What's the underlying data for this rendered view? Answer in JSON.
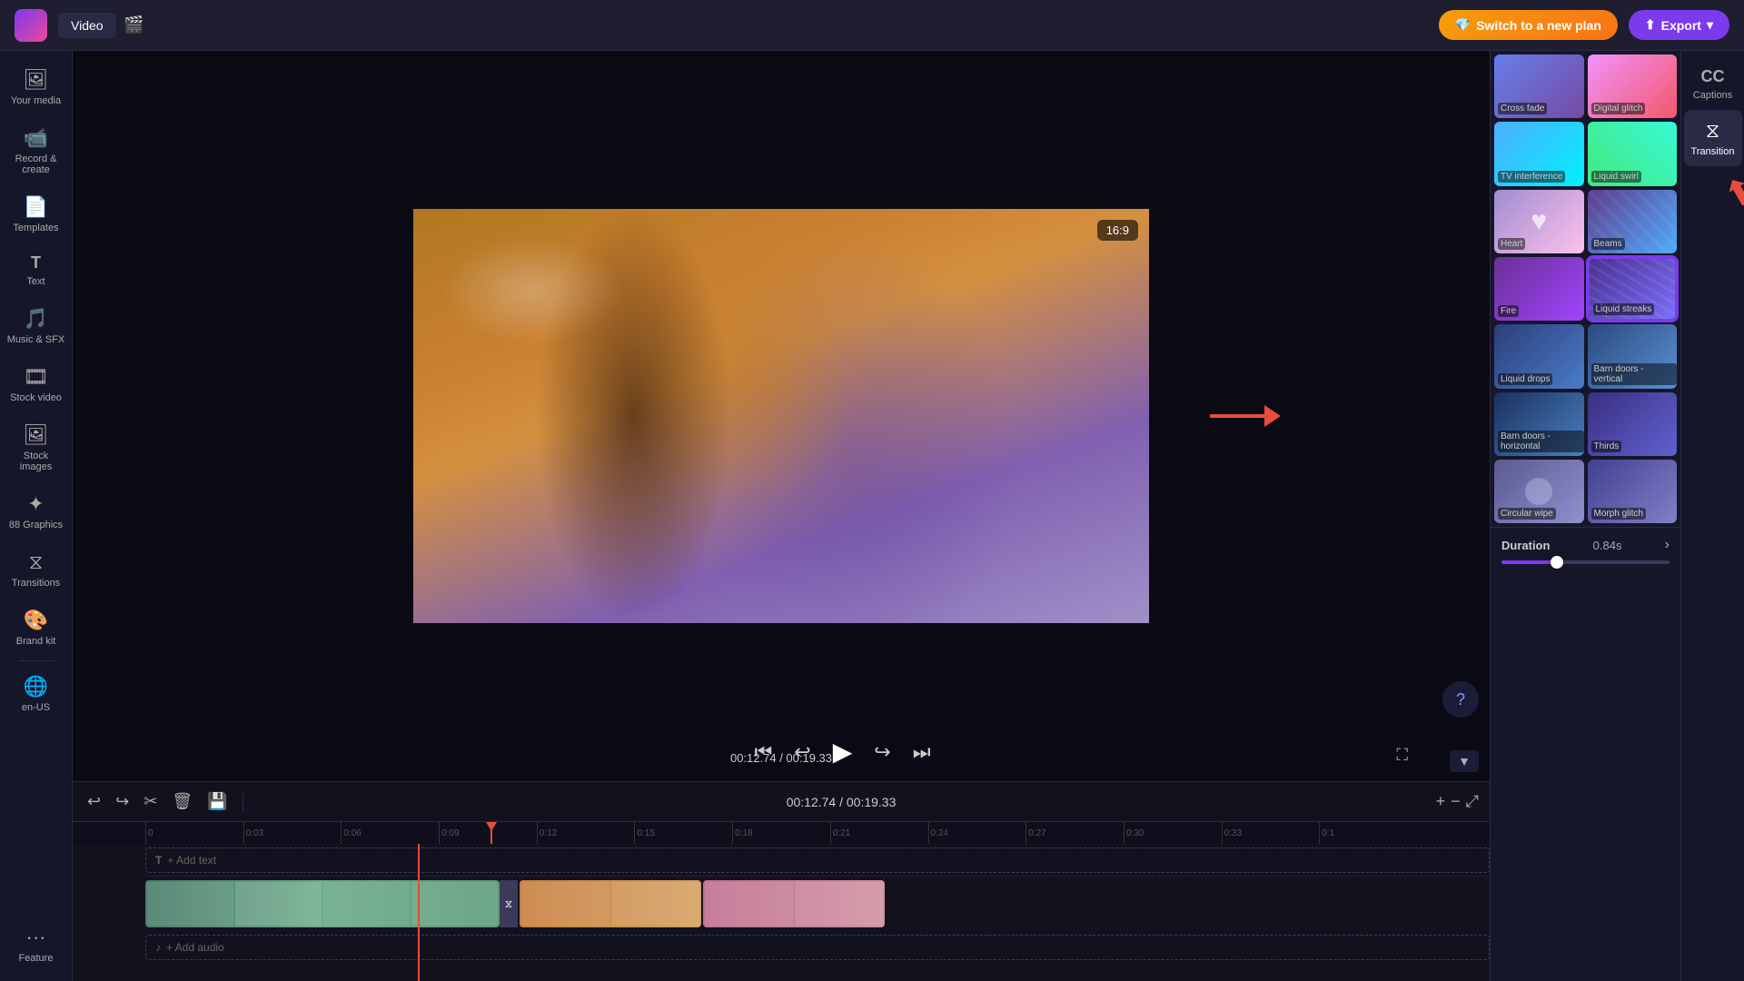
{
  "topbar": {
    "tabs": [
      {
        "id": "video",
        "label": "Video",
        "active": true
      },
      {
        "id": "auto",
        "label": "🎬",
        "active": false
      }
    ],
    "switch_plan_label": "Switch to a new plan",
    "export_label": "Export"
  },
  "left_sidebar": {
    "items": [
      {
        "id": "your-media",
        "icon": "🖼",
        "label": "Your media"
      },
      {
        "id": "record-create",
        "icon": "📹",
        "label": "Record & create"
      },
      {
        "id": "templates",
        "icon": "📄",
        "label": "Templates"
      },
      {
        "id": "text",
        "icon": "T",
        "label": "Text"
      },
      {
        "id": "music-sfx",
        "icon": "🎵",
        "label": "Music & SFX"
      },
      {
        "id": "stock-video",
        "icon": "🎞",
        "label": "Stock video"
      },
      {
        "id": "stock-images",
        "icon": "🖼",
        "label": "Stock images"
      },
      {
        "id": "graphics",
        "icon": "✦",
        "label": "88 Graphics"
      },
      {
        "id": "transitions",
        "icon": "🔀",
        "label": "Transitions"
      },
      {
        "id": "brand-kit",
        "icon": "🎨",
        "label": "Brand kit"
      },
      {
        "id": "en-us",
        "icon": "🌐",
        "label": "en-US"
      },
      {
        "id": "more",
        "icon": "···",
        "label": "Feature"
      }
    ]
  },
  "right_sidebar": {
    "items": [
      {
        "id": "captions",
        "icon": "CC",
        "label": "Captions"
      },
      {
        "id": "transition",
        "icon": "⧖",
        "label": "Transition",
        "active": true
      }
    ]
  },
  "video_preview": {
    "aspect_ratio": "16:9",
    "time_current": "00:12.74",
    "time_total": "00:19.33",
    "time_display": "00:12.74 / 00:19.33"
  },
  "transitions_panel": {
    "items": [
      {
        "id": "cross-fade",
        "label": "Cross fade",
        "style": "t-crossfade"
      },
      {
        "id": "digital-glitch",
        "label": "Digital glitch",
        "style": "t-digitalglitch"
      },
      {
        "id": "tv-interference",
        "label": "TV interference",
        "style": "t-tvinterference"
      },
      {
        "id": "liquid-swirl",
        "label": "Liquid swirl",
        "style": "t-liquidswirl"
      },
      {
        "id": "heart",
        "label": "Heart",
        "style": "t-heart",
        "has_heart": true
      },
      {
        "id": "beams",
        "label": "Beams",
        "style": "t-beams"
      },
      {
        "id": "fire",
        "label": "Fire",
        "style": "t-fire"
      },
      {
        "id": "liquid-streaks",
        "label": "Liquid streaks",
        "style": "t-liquidstreaks",
        "selected": true
      },
      {
        "id": "liquid-drops",
        "label": "Liquid drops",
        "style": "t-liquiddrops"
      },
      {
        "id": "barn-doors-vertical",
        "label": "Barn doors - vertical",
        "style": "t-barndoorsv"
      },
      {
        "id": "barn-doors-horizontal",
        "label": "Barn doors - horizontal",
        "style": "t-barndoorsh"
      },
      {
        "id": "thirds",
        "label": "Thirds",
        "style": "t-thirds"
      },
      {
        "id": "circular-wipe",
        "label": "Circular wipe",
        "style": "t-circwipe"
      },
      {
        "id": "morph-glitch",
        "label": "Morph glitch",
        "style": "t-morphglitch"
      }
    ]
  },
  "duration": {
    "label": "Duration",
    "value": "0.84s",
    "percent": 30
  },
  "timeline": {
    "time_display": "00:12.74 / 00:19.33",
    "ruler_marks": [
      "0",
      "0:03",
      "0:06",
      "0:09",
      "0:12",
      "0:15",
      "0:18",
      "0:21",
      "0:24",
      "0:27",
      "0:30",
      "0:33",
      "0:1"
    ],
    "add_text_label": "+ Add text",
    "add_audio_label": "+ Add audio"
  }
}
